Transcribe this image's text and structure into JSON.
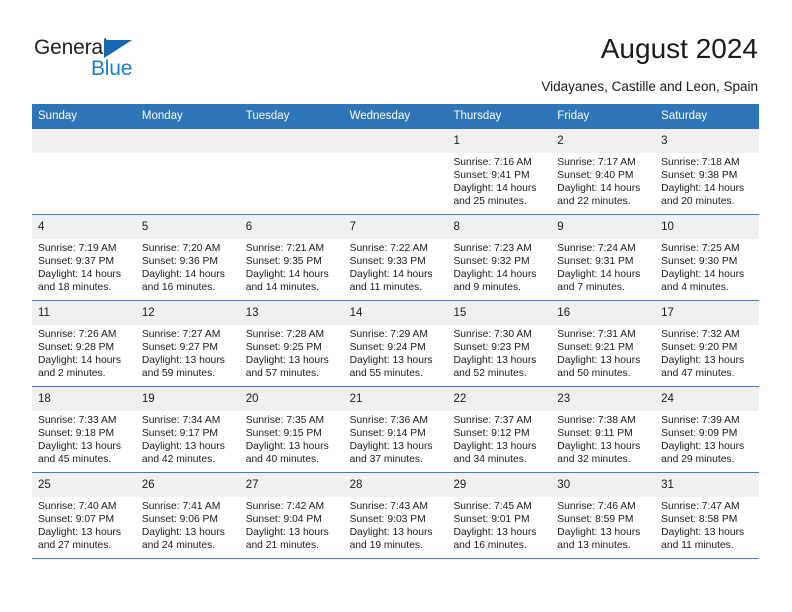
{
  "brand": {
    "name_part1": "General",
    "name_part2": "Blue",
    "triangle_icon": "triangle-icon",
    "color_dark": "#231f20",
    "color_blue": "#1b7fd4"
  },
  "header": {
    "title": "August 2024",
    "subtitle": "Vidayanes, Castille and Leon, Spain"
  },
  "calendar": {
    "accent_color": "#2d74b8",
    "date_band_color": "#f0f0f0",
    "weekdays": [
      "Sunday",
      "Monday",
      "Tuesday",
      "Wednesday",
      "Thursday",
      "Friday",
      "Saturday"
    ],
    "weeks": [
      [
        {
          "day": "",
          "empty": true,
          "sunrise": "",
          "sunset": "",
          "daylight_1": "",
          "daylight_2": ""
        },
        {
          "day": "",
          "empty": true,
          "sunrise": "",
          "sunset": "",
          "daylight_1": "",
          "daylight_2": ""
        },
        {
          "day": "",
          "empty": true,
          "sunrise": "",
          "sunset": "",
          "daylight_1": "",
          "daylight_2": ""
        },
        {
          "day": "",
          "empty": true,
          "sunrise": "",
          "sunset": "",
          "daylight_1": "",
          "daylight_2": ""
        },
        {
          "day": "1",
          "empty": false,
          "sunrise": "Sunrise: 7:16 AM",
          "sunset": "Sunset: 9:41 PM",
          "daylight_1": "Daylight: 14 hours",
          "daylight_2": "and 25 minutes."
        },
        {
          "day": "2",
          "empty": false,
          "sunrise": "Sunrise: 7:17 AM",
          "sunset": "Sunset: 9:40 PM",
          "daylight_1": "Daylight: 14 hours",
          "daylight_2": "and 22 minutes."
        },
        {
          "day": "3",
          "empty": false,
          "sunrise": "Sunrise: 7:18 AM",
          "sunset": "Sunset: 9:38 PM",
          "daylight_1": "Daylight: 14 hours",
          "daylight_2": "and 20 minutes."
        }
      ],
      [
        {
          "day": "4",
          "empty": false,
          "sunrise": "Sunrise: 7:19 AM",
          "sunset": "Sunset: 9:37 PM",
          "daylight_1": "Daylight: 14 hours",
          "daylight_2": "and 18 minutes."
        },
        {
          "day": "5",
          "empty": false,
          "sunrise": "Sunrise: 7:20 AM",
          "sunset": "Sunset: 9:36 PM",
          "daylight_1": "Daylight: 14 hours",
          "daylight_2": "and 16 minutes."
        },
        {
          "day": "6",
          "empty": false,
          "sunrise": "Sunrise: 7:21 AM",
          "sunset": "Sunset: 9:35 PM",
          "daylight_1": "Daylight: 14 hours",
          "daylight_2": "and 14 minutes."
        },
        {
          "day": "7",
          "empty": false,
          "sunrise": "Sunrise: 7:22 AM",
          "sunset": "Sunset: 9:33 PM",
          "daylight_1": "Daylight: 14 hours",
          "daylight_2": "and 11 minutes."
        },
        {
          "day": "8",
          "empty": false,
          "sunrise": "Sunrise: 7:23 AM",
          "sunset": "Sunset: 9:32 PM",
          "daylight_1": "Daylight: 14 hours",
          "daylight_2": "and 9 minutes."
        },
        {
          "day": "9",
          "empty": false,
          "sunrise": "Sunrise: 7:24 AM",
          "sunset": "Sunset: 9:31 PM",
          "daylight_1": "Daylight: 14 hours",
          "daylight_2": "and 7 minutes."
        },
        {
          "day": "10",
          "empty": false,
          "sunrise": "Sunrise: 7:25 AM",
          "sunset": "Sunset: 9:30 PM",
          "daylight_1": "Daylight: 14 hours",
          "daylight_2": "and 4 minutes."
        }
      ],
      [
        {
          "day": "11",
          "empty": false,
          "sunrise": "Sunrise: 7:26 AM",
          "sunset": "Sunset: 9:28 PM",
          "daylight_1": "Daylight: 14 hours",
          "daylight_2": "and 2 minutes."
        },
        {
          "day": "12",
          "empty": false,
          "sunrise": "Sunrise: 7:27 AM",
          "sunset": "Sunset: 9:27 PM",
          "daylight_1": "Daylight: 13 hours",
          "daylight_2": "and 59 minutes."
        },
        {
          "day": "13",
          "empty": false,
          "sunrise": "Sunrise: 7:28 AM",
          "sunset": "Sunset: 9:25 PM",
          "daylight_1": "Daylight: 13 hours",
          "daylight_2": "and 57 minutes."
        },
        {
          "day": "14",
          "empty": false,
          "sunrise": "Sunrise: 7:29 AM",
          "sunset": "Sunset: 9:24 PM",
          "daylight_1": "Daylight: 13 hours",
          "daylight_2": "and 55 minutes."
        },
        {
          "day": "15",
          "empty": false,
          "sunrise": "Sunrise: 7:30 AM",
          "sunset": "Sunset: 9:23 PM",
          "daylight_1": "Daylight: 13 hours",
          "daylight_2": "and 52 minutes."
        },
        {
          "day": "16",
          "empty": false,
          "sunrise": "Sunrise: 7:31 AM",
          "sunset": "Sunset: 9:21 PM",
          "daylight_1": "Daylight: 13 hours",
          "daylight_2": "and 50 minutes."
        },
        {
          "day": "17",
          "empty": false,
          "sunrise": "Sunrise: 7:32 AM",
          "sunset": "Sunset: 9:20 PM",
          "daylight_1": "Daylight: 13 hours",
          "daylight_2": "and 47 minutes."
        }
      ],
      [
        {
          "day": "18",
          "empty": false,
          "sunrise": "Sunrise: 7:33 AM",
          "sunset": "Sunset: 9:18 PM",
          "daylight_1": "Daylight: 13 hours",
          "daylight_2": "and 45 minutes."
        },
        {
          "day": "19",
          "empty": false,
          "sunrise": "Sunrise: 7:34 AM",
          "sunset": "Sunset: 9:17 PM",
          "daylight_1": "Daylight: 13 hours",
          "daylight_2": "and 42 minutes."
        },
        {
          "day": "20",
          "empty": false,
          "sunrise": "Sunrise: 7:35 AM",
          "sunset": "Sunset: 9:15 PM",
          "daylight_1": "Daylight: 13 hours",
          "daylight_2": "and 40 minutes."
        },
        {
          "day": "21",
          "empty": false,
          "sunrise": "Sunrise: 7:36 AM",
          "sunset": "Sunset: 9:14 PM",
          "daylight_1": "Daylight: 13 hours",
          "daylight_2": "and 37 minutes."
        },
        {
          "day": "22",
          "empty": false,
          "sunrise": "Sunrise: 7:37 AM",
          "sunset": "Sunset: 9:12 PM",
          "daylight_1": "Daylight: 13 hours",
          "daylight_2": "and 34 minutes."
        },
        {
          "day": "23",
          "empty": false,
          "sunrise": "Sunrise: 7:38 AM",
          "sunset": "Sunset: 9:11 PM",
          "daylight_1": "Daylight: 13 hours",
          "daylight_2": "and 32 minutes."
        },
        {
          "day": "24",
          "empty": false,
          "sunrise": "Sunrise: 7:39 AM",
          "sunset": "Sunset: 9:09 PM",
          "daylight_1": "Daylight: 13 hours",
          "daylight_2": "and 29 minutes."
        }
      ],
      [
        {
          "day": "25",
          "empty": false,
          "sunrise": "Sunrise: 7:40 AM",
          "sunset": "Sunset: 9:07 PM",
          "daylight_1": "Daylight: 13 hours",
          "daylight_2": "and 27 minutes."
        },
        {
          "day": "26",
          "empty": false,
          "sunrise": "Sunrise: 7:41 AM",
          "sunset": "Sunset: 9:06 PM",
          "daylight_1": "Daylight: 13 hours",
          "daylight_2": "and 24 minutes."
        },
        {
          "day": "27",
          "empty": false,
          "sunrise": "Sunrise: 7:42 AM",
          "sunset": "Sunset: 9:04 PM",
          "daylight_1": "Daylight: 13 hours",
          "daylight_2": "and 21 minutes."
        },
        {
          "day": "28",
          "empty": false,
          "sunrise": "Sunrise: 7:43 AM",
          "sunset": "Sunset: 9:03 PM",
          "daylight_1": "Daylight: 13 hours",
          "daylight_2": "and 19 minutes."
        },
        {
          "day": "29",
          "empty": false,
          "sunrise": "Sunrise: 7:45 AM",
          "sunset": "Sunset: 9:01 PM",
          "daylight_1": "Daylight: 13 hours",
          "daylight_2": "and 16 minutes."
        },
        {
          "day": "30",
          "empty": false,
          "sunrise": "Sunrise: 7:46 AM",
          "sunset": "Sunset: 8:59 PM",
          "daylight_1": "Daylight: 13 hours",
          "daylight_2": "and 13 minutes."
        },
        {
          "day": "31",
          "empty": false,
          "sunrise": "Sunrise: 7:47 AM",
          "sunset": "Sunset: 8:58 PM",
          "daylight_1": "Daylight: 13 hours",
          "daylight_2": "and 11 minutes."
        }
      ]
    ]
  }
}
